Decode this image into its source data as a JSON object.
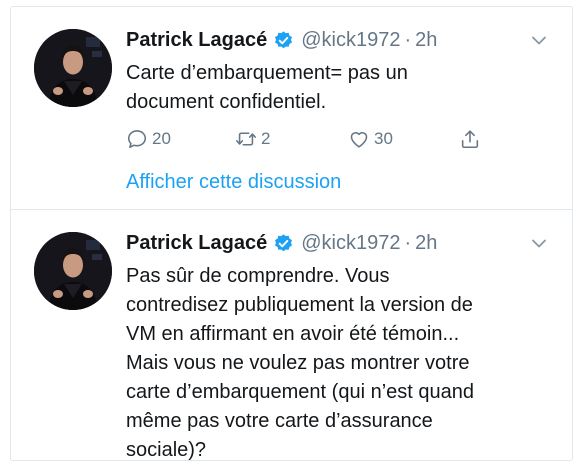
{
  "colors": {
    "text": "#14171a",
    "secondary": "#657786",
    "link": "#1da1f2",
    "verified": "#1da1f2",
    "border": "#e1e8ed"
  },
  "tweets": [
    {
      "author_name": "Patrick Lagacé",
      "verified_icon": "verified-badge-icon",
      "handle": "@kick1972",
      "separator": "·",
      "time": "2h",
      "text": "Carte d’embarquement= pas un\ndocument confidentiel.",
      "actions": {
        "reply_count": "20",
        "retweet_count": "2",
        "like_count": "30"
      },
      "show_thread_label": "Afficher cette discussion"
    },
    {
      "author_name": "Patrick Lagacé",
      "verified_icon": "verified-badge-icon",
      "handle": "@kick1972",
      "separator": "·",
      "time": "2h",
      "text": "Pas sûr de comprendre. Vous\ncontredisez publiquement la version de\nVM en affirmant en avoir été témoin...\nMais vous ne voulez pas montrer votre\ncarte d’embarquement  (qui n’est quand\nmême pas votre carte d’assurance\nsociale)?"
    }
  ]
}
